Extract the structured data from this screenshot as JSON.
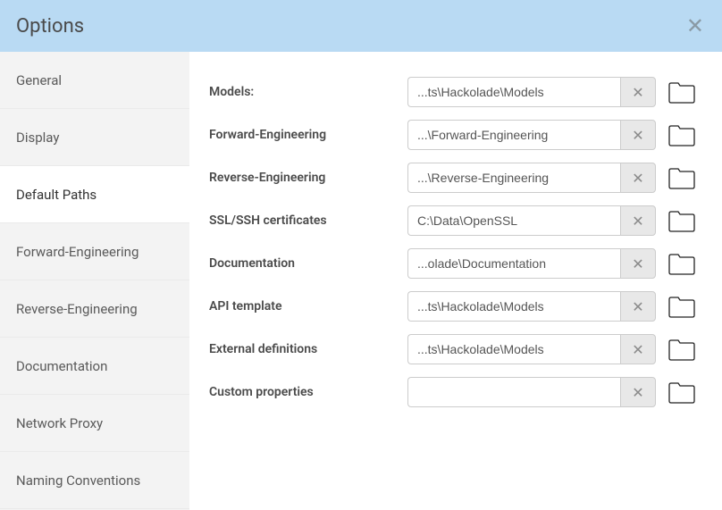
{
  "header": {
    "title": "Options"
  },
  "sidebar": {
    "items": [
      {
        "label": "General"
      },
      {
        "label": "Display"
      },
      {
        "label": "Default Paths"
      },
      {
        "label": "Forward-Engineering"
      },
      {
        "label": "Reverse-Engineering"
      },
      {
        "label": "Documentation"
      },
      {
        "label": "Network Proxy"
      },
      {
        "label": "Naming Conventions"
      }
    ],
    "activeIndex": 2
  },
  "rows": [
    {
      "label": "Models:",
      "value": "...ts\\Hackolade\\Models"
    },
    {
      "label": "Forward-Engineering",
      "value": "...\\Forward-Engineering"
    },
    {
      "label": "Reverse-Engineering",
      "value": "...\\Reverse-Engineering"
    },
    {
      "label": "SSL/SSH certificates",
      "value": "C:\\Data\\OpenSSL"
    },
    {
      "label": "Documentation",
      "value": "...olade\\Documentation"
    },
    {
      "label": "API template",
      "value": "...ts\\Hackolade\\Models"
    },
    {
      "label": "External definitions",
      "value": "...ts\\Hackolade\\Models"
    },
    {
      "label": "Custom properties",
      "value": ""
    }
  ]
}
